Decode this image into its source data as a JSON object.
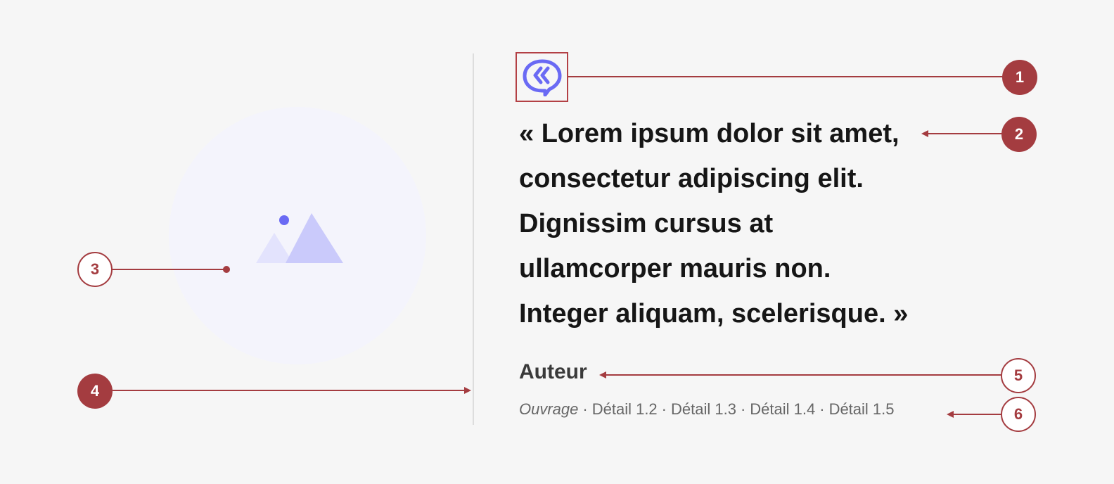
{
  "quote": {
    "lines": [
      "« Lorem ipsum dolor sit amet,",
      "consectetur adipiscing elit.",
      "Dignissim cursus at",
      "ullamcorper mauris non.",
      "Integer aliquam, scelerisque. »"
    ],
    "author": "Auteur",
    "source": {
      "work": "Ouvrage",
      "details": [
        "Détail 1.2",
        "Détail 1.3",
        "Détail 1.4",
        "Détail 1.5"
      ]
    }
  },
  "markers": [
    "1",
    "2",
    "3",
    "4",
    "5",
    "6"
  ],
  "icons": {
    "quote": "quote-bubble-icon",
    "image": "image-placeholder-icon"
  },
  "colors": {
    "annotation": "#a43c40",
    "accent": "#6a6af4",
    "image_bg": "#f4f4fc",
    "text": "#161616"
  }
}
